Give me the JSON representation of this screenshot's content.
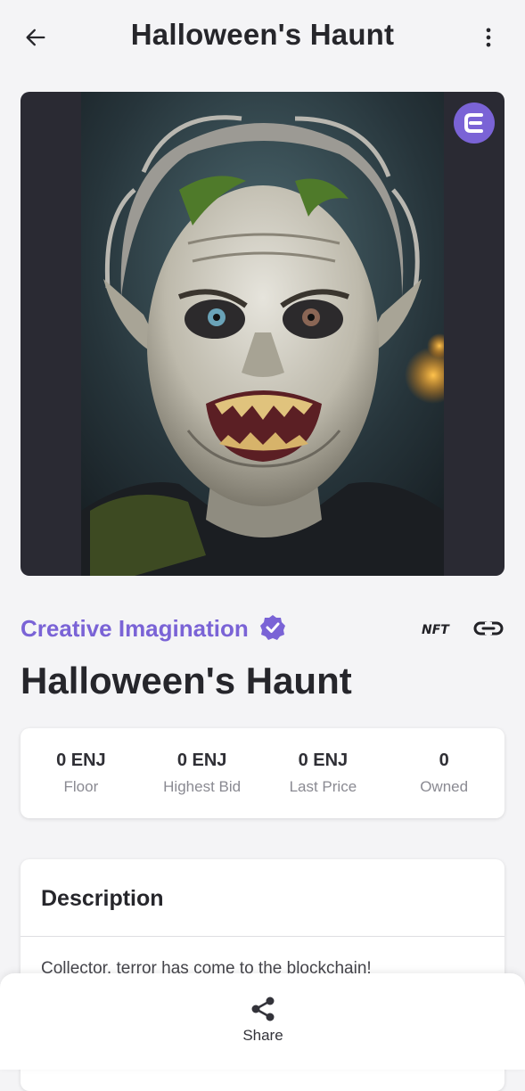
{
  "header": {
    "title": "Halloween's Haunt",
    "back_icon": "arrow-left-icon",
    "more_icon": "more-vertical-icon"
  },
  "media": {
    "badge_icon": "enjin-logo-icon",
    "artwork": "zombie-portrait"
  },
  "collection": {
    "name": "Creative Imagination",
    "verified_icon": "verified-badge-icon",
    "nft_icon": "nft-icon",
    "link_icon": "link-icon"
  },
  "item": {
    "title": "Halloween's Haunt"
  },
  "stats": [
    {
      "value": "0 ENJ",
      "label": "Floor"
    },
    {
      "value": "0 ENJ",
      "label": "Highest Bid"
    },
    {
      "value": "0 ENJ",
      "label": "Last Price"
    },
    {
      "value": "0",
      "label": "Owned"
    }
  ],
  "description": {
    "title": "Description",
    "text": "Collector, terror has come to the blockchain!"
  },
  "bottom_bar": {
    "share_label": "Share",
    "share_icon": "share-icon"
  },
  "colors": {
    "accent": "#7a63d6",
    "background": "#f4f4f6",
    "card": "#ffffff",
    "text": "#26262b",
    "muted": "#8a8a92"
  }
}
